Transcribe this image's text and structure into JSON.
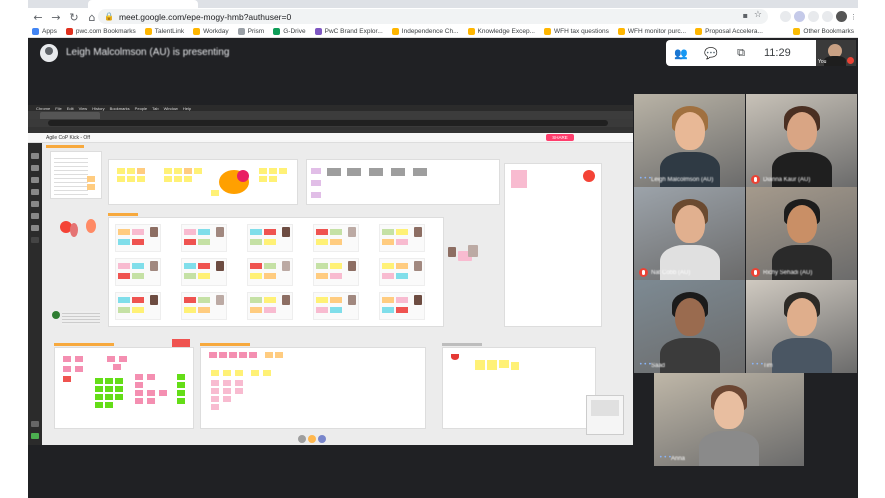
{
  "browser": {
    "url": "meet.google.com/epe-mogy-hmb?authuser=0",
    "nav": {
      "back": "←",
      "forward": "→",
      "reload": "↻",
      "home": "⌂"
    },
    "bookmarks": [
      {
        "label": "Apps",
        "color": "#4285f4"
      },
      {
        "label": "pwc.com Bookmarks",
        "color": "#e0301e"
      },
      {
        "label": "TalentLink",
        "color": "#ffb600"
      },
      {
        "label": "Workday",
        "color": "#ffb600"
      },
      {
        "label": "Prism",
        "color": "#9aa0a6"
      },
      {
        "label": "G-Drive",
        "color": "#0f9d58"
      },
      {
        "label": "PwC Brand Explor...",
        "color": "#7e57c2"
      },
      {
        "label": "Independence Ch...",
        "color": "#ffb600"
      },
      {
        "label": "Knowledge Excep...",
        "color": "#ffb600"
      },
      {
        "label": "WFH tax questions",
        "color": "#ffb600"
      },
      {
        "label": "WFH monitor purc...",
        "color": "#ffb600"
      },
      {
        "label": "Proposal Accelera...",
        "color": "#ffb600"
      }
    ],
    "other_bookmarks": "Other Bookmarks",
    "icons": {
      "lock": "🔒",
      "star": "☆",
      "camera": "▪"
    }
  },
  "meet": {
    "presenting_text": "Leigh Malcolmson (AU) is presenting",
    "time": "11:29",
    "self_label": "You",
    "controls": {
      "people": "👥",
      "chat": "💬",
      "activities": "⧉"
    },
    "participants": [
      {
        "name": "Leigh Malcolmson (AU)",
        "muted": false,
        "bg": "#b9b3a6",
        "skin": "#e8b896",
        "hair": "#a0703f",
        "shirt": "#2f3a44"
      },
      {
        "name": "Dianna Kaur (AU)",
        "muted": true,
        "bg": "#c8c2b8",
        "skin": "#d9a584",
        "hair": "#4a2f22",
        "shirt": "#1f1f1f"
      },
      {
        "name": "Nat Cobb (AU)",
        "muted": true,
        "bg": "#9ca3aa",
        "skin": "#e1b08f",
        "hair": "#6b4a30",
        "shirt": "#e0e0e0"
      },
      {
        "name": "Richy Sehadi (AU)",
        "muted": true,
        "bg": "#a59a8c",
        "skin": "#c98f66",
        "hair": "#1c1c1c",
        "shirt": "#2a2a2a"
      },
      {
        "name": "Saad",
        "muted": false,
        "bg": "#7d8a93",
        "skin": "#9a6b4f",
        "hair": "#1b1b1b",
        "shirt": "#3b3b3b"
      },
      {
        "name": "Tim",
        "muted": false,
        "bg": "#cfc9c0",
        "skin": "#dfae8c",
        "hair": "#2d2a26",
        "shirt": "#4a5663"
      },
      {
        "name": "Anna",
        "muted": false,
        "bg": "#bfb7a8",
        "skin": "#e8bea0",
        "hair": "#6b4632",
        "shirt": "#8a8a8a"
      }
    ]
  },
  "shared_screen": {
    "board_name": "Agile CoP Kick - Off",
    "share_label": "SHARE",
    "mac_menu": [
      "Chrome",
      "File",
      "Edit",
      "View",
      "History",
      "Bookmarks",
      "People",
      "Tab",
      "Window",
      "Help"
    ]
  }
}
